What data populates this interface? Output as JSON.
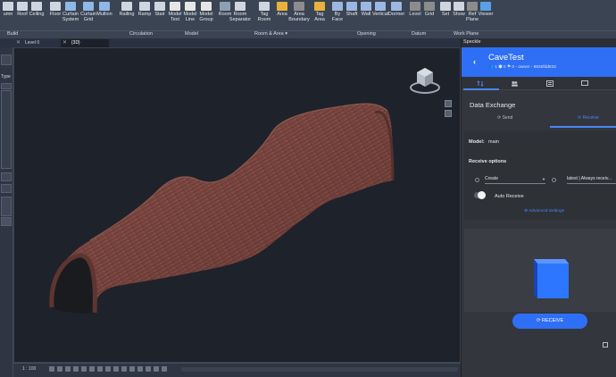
{
  "ribbon": {
    "buttons": [
      {
        "id": "column",
        "label": "umn",
        "color": "#cfd6e0"
      },
      {
        "id": "roof",
        "label": "Roof",
        "color": "#cfd6e0"
      },
      {
        "id": "ceiling",
        "label": "Ceiling",
        "color": "#cfd6e0"
      },
      {
        "id": "floor",
        "label": "Floor",
        "color": "#cfd6e0"
      },
      {
        "id": "curtain-system",
        "label": "Curtain\nSystem",
        "color": "#8fb7e8"
      },
      {
        "id": "curtain-grid",
        "label": "Curtain\nGrid",
        "color": "#8fb7e8"
      },
      {
        "id": "mullion",
        "label": "Mullion",
        "color": "#8fb7e8"
      },
      {
        "id": "railing",
        "label": "Railing",
        "color": "#cfd6e0"
      },
      {
        "id": "ramp",
        "label": "Ramp",
        "color": "#cfd6e0"
      },
      {
        "id": "stair",
        "label": "Stair",
        "color": "#cfd6e0"
      },
      {
        "id": "model-text",
        "label": "Model\nText",
        "color": "#e6e6e6"
      },
      {
        "id": "model-line",
        "label": "Model\nLine",
        "color": "#e6e6e6"
      },
      {
        "id": "model-group",
        "label": "Model\nGroup",
        "color": "#e6e6e6"
      },
      {
        "id": "room",
        "label": "Room",
        "color": "#8fa0b5"
      },
      {
        "id": "room-separator",
        "label": "Room\nSeparator",
        "color": "#cfd6e0"
      },
      {
        "id": "tag-room",
        "label": "Tag\nRoom",
        "color": "#cfd6e0"
      },
      {
        "id": "area",
        "label": "Area",
        "color": "#e8b13a"
      },
      {
        "id": "area-boundary",
        "label": "Area\nBoundary",
        "color": "#8c8c8c"
      },
      {
        "id": "tag-area",
        "label": "Tag\nArea",
        "color": "#e8b13a"
      },
      {
        "id": "by-face",
        "label": "By\nFace",
        "color": "#9bb8e0"
      },
      {
        "id": "shaft",
        "label": "Shaft",
        "color": "#9bb8e0"
      },
      {
        "id": "wall",
        "label": "Wall",
        "color": "#9bb8e0"
      },
      {
        "id": "vertical",
        "label": "Vertical",
        "color": "#9bb8e0"
      },
      {
        "id": "dormer",
        "label": "Dormer",
        "color": "#9bb8e0"
      },
      {
        "id": "level",
        "label": "Level",
        "color": "#8c8c8c"
      },
      {
        "id": "grid",
        "label": "Grid",
        "color": "#8c8c8c"
      },
      {
        "id": "set",
        "label": "Set",
        "color": "#cfd6e0"
      },
      {
        "id": "show",
        "label": "Show",
        "color": "#cfd6e0"
      },
      {
        "id": "ref-plane",
        "label": "Ref\nPlane",
        "color": "#8c8c8c"
      },
      {
        "id": "viewer",
        "label": "Viewer",
        "color": "#5aa0e8"
      }
    ],
    "groups": [
      {
        "label": "Build"
      },
      {
        "label": "Circulation"
      },
      {
        "label": "Model"
      },
      {
        "label": "Room & Area ▾"
      },
      {
        "label": "Opening"
      },
      {
        "label": "Datum"
      },
      {
        "label": "Work Plane"
      }
    ]
  },
  "tabs": [
    {
      "label": "Level 0",
      "active": false
    },
    {
      "label": "{3D}",
      "active": true
    }
  ],
  "left_strip": {
    "label": "Type"
  },
  "status": {
    "scale": "1 : 100"
  },
  "speckle": {
    "window_title": "Speckle",
    "stream_name": "CaveTest",
    "stream_meta": "👥 1  ⬢ 0  ⚑ 0 - owner - 8830fdd632",
    "section_title": "Data Exchange",
    "send_label": "Send",
    "receive_tab_label": "Receive",
    "model_label": "Model:",
    "model_value": "main",
    "receive_options_label": "Receive options",
    "mode_value": "Create",
    "commit_value": "latest | Always receiv...",
    "auto_receive_label": "Auto Receive",
    "advanced_settings_label": "Advanced Settings",
    "receive_button_label": "RECEIVE",
    "accent_color": "#2f6ff6"
  }
}
